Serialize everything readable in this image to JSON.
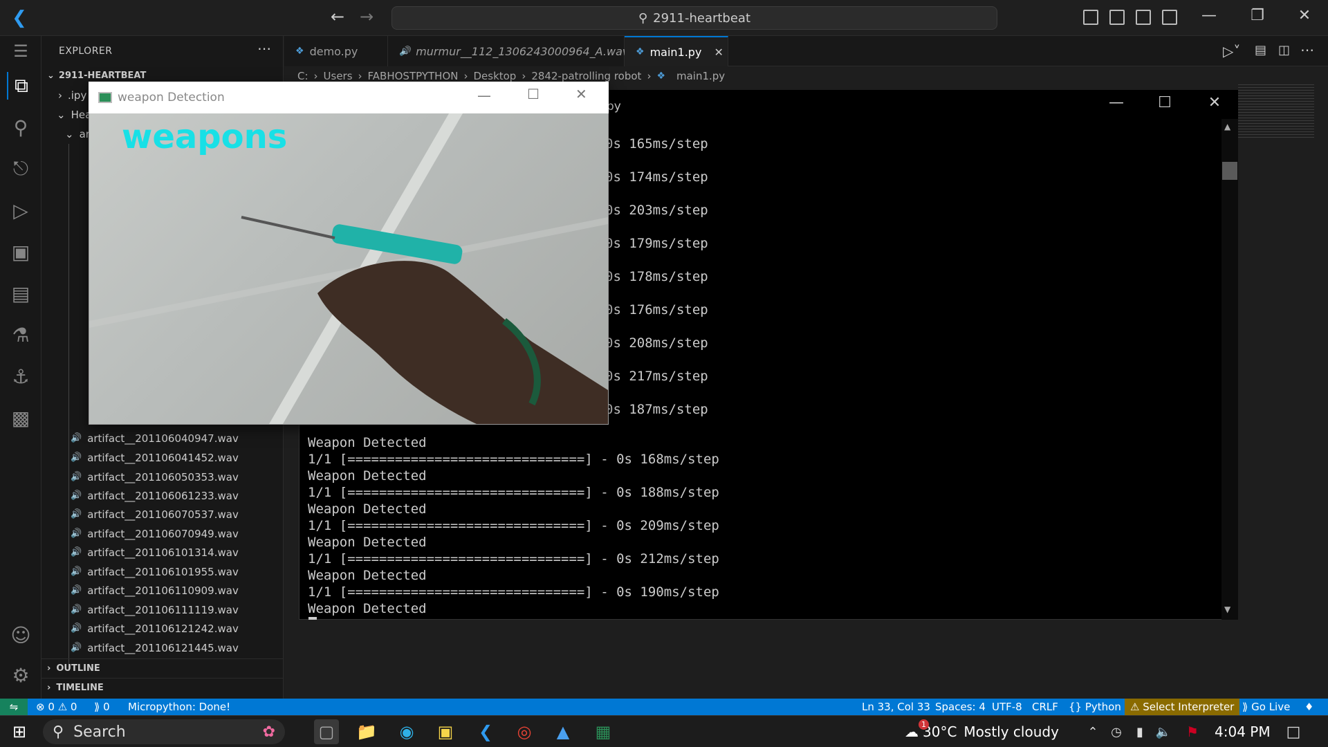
{
  "titlebar": {
    "search": "2911-heartbeat"
  },
  "sidebar": {
    "title": "EXPLORER",
    "root": "2911-HEARTBEAT",
    "folders": [
      ".ipy",
      "Hea",
      "ar"
    ],
    "files": [
      "artifact__201106040947.wav",
      "artifact__201106041452.wav",
      "artifact__201106050353.wav",
      "artifact__201106061233.wav",
      "artifact__201106070537.wav",
      "artifact__201106070949.wav",
      "artifact__201106101314.wav",
      "artifact__201106101955.wav",
      "artifact__201106110909.wav",
      "artifact__201106111119.wav",
      "artifact__201106121242.wav",
      "artifact__201106121445.wav"
    ],
    "outline": "OUTLINE",
    "timeline": "TIMELINE"
  },
  "tabs": [
    {
      "label": "demo.py"
    },
    {
      "label": "murmur__112_1306243000964_A.wav"
    },
    {
      "label": "main1.py"
    }
  ],
  "breadcrumb": [
    "C:",
    "Users",
    "FABHOSTPYTHON",
    "Desktop",
    "2842-patrolling robot",
    "main1.py"
  ],
  "console": {
    "title_fragment": "py",
    "lines": [
      "0s 165ms/step",
      "0s 174ms/step",
      "0s 203ms/step",
      "0s 179ms/step",
      "0s 178ms/step",
      "0s 176ms/step",
      "0s 208ms/step",
      "0s 217ms/step",
      "0s 187ms/step",
      "Weapon Detected",
      "1/1 [==============================] - 0s 168ms/step",
      "Weapon Detected",
      "1/1 [==============================] - 0s 188ms/step",
      "Weapon Detected",
      "1/1 [==============================] - 0s 209ms/step",
      "Weapon Detected",
      "1/1 [==============================] - 0s 212ms/step",
      "Weapon Detected",
      "1/1 [==============================] - 0s 190ms/step",
      "Weapon Detected"
    ]
  },
  "weapon_window": {
    "title": "weapon Detection",
    "label": "weapons"
  },
  "status": {
    "errors": "0",
    "warnings": "0",
    "ports": "0",
    "micropython": "Micropython: Done!",
    "position": "Ln 33, Col 33",
    "spaces": "Spaces: 4",
    "encoding": "UTF-8",
    "eol": "CRLF",
    "language": "Python",
    "interpreter": "Select Interpreter",
    "golive": "Go Live"
  },
  "taskbar": {
    "search": "Search",
    "weather_temp": "30°C",
    "weather_desc": "Mostly cloudy",
    "weather_badge": "1",
    "time": "4:04 PM"
  }
}
